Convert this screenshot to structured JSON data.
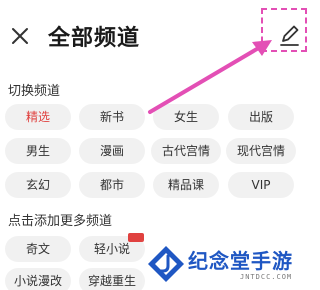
{
  "header": {
    "title": "全部频道",
    "close_icon": "close-icon",
    "edit_icon": "pencil-icon"
  },
  "switch_section": {
    "label": "切换频道",
    "items": [
      {
        "label": "精选",
        "selected": true
      },
      {
        "label": "新书",
        "selected": false
      },
      {
        "label": "女生",
        "selected": false
      },
      {
        "label": "出版",
        "selected": false
      },
      {
        "label": "男生",
        "selected": false
      },
      {
        "label": "漫画",
        "selected": false
      },
      {
        "label": "古代宫情",
        "selected": false
      },
      {
        "label": "现代宫情",
        "selected": false
      },
      {
        "label": "玄幻",
        "selected": false
      },
      {
        "label": "都市",
        "selected": false
      },
      {
        "label": "精品课",
        "selected": false
      },
      {
        "label": "VIP",
        "selected": false
      }
    ]
  },
  "add_section": {
    "label": "点击添加更多频道",
    "items": [
      {
        "label": "奇文"
      },
      {
        "label": "轻小说"
      },
      {
        "label": "小说漫改"
      },
      {
        "label": "穿越重生"
      }
    ]
  },
  "annotation": {
    "color": "#e34fb5"
  },
  "watermark": {
    "text": "纪念堂手游",
    "sub": "JNTDCC.COM",
    "color": "#1f57c3"
  },
  "colors": {
    "selected": "#e0413f",
    "chip_bg": "#f1f1f1"
  }
}
